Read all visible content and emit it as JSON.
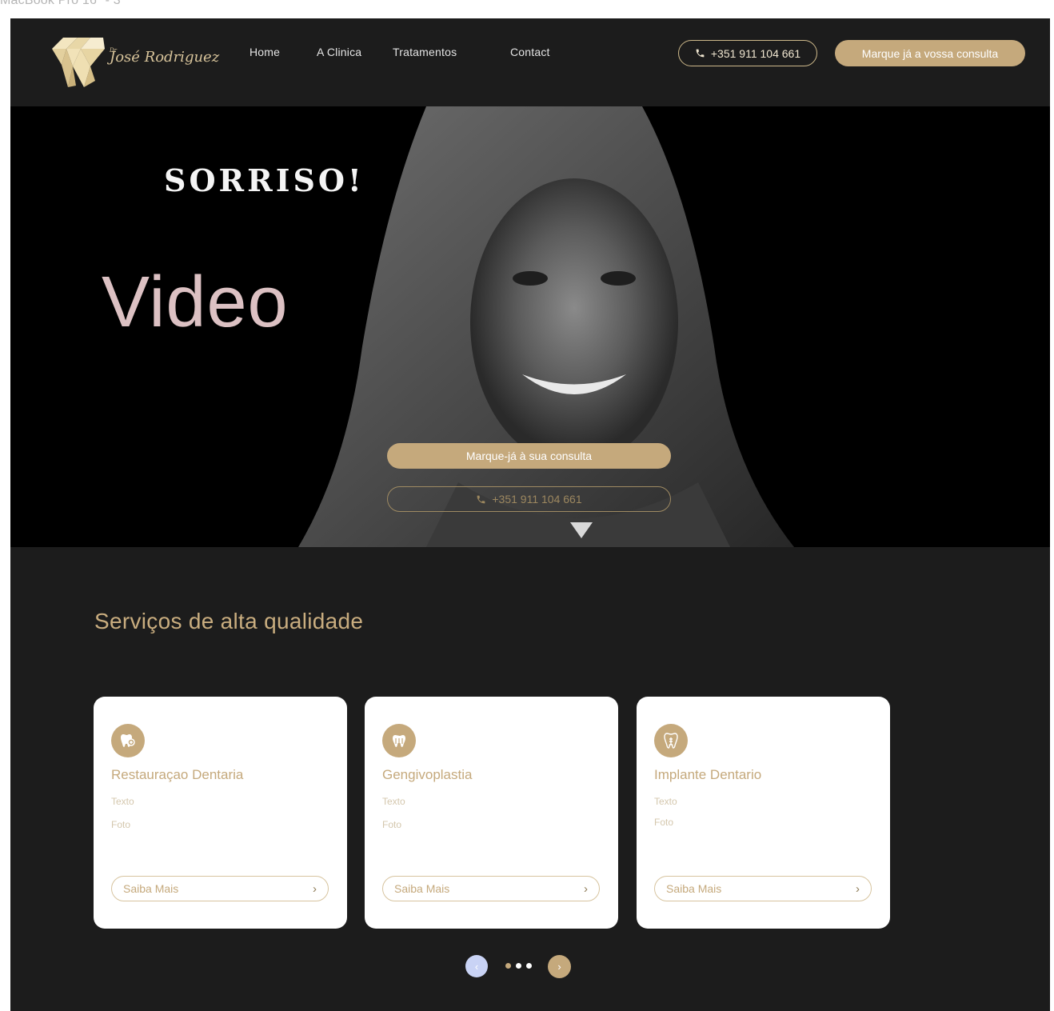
{
  "frame_label": "MacBook Pro 16\" - 3",
  "header": {
    "logo_dr": "Dr",
    "logo_name": "José Rodriguez",
    "nav": [
      "Home",
      "A Clinica",
      "Tratamentos",
      "Contact"
    ],
    "phone": "+351 911 104 661",
    "cta": "Marque já a vossa consulta"
  },
  "hero": {
    "brand": "SORRISO!",
    "video_label": "Video",
    "cta": "Marque-já à sua consulta",
    "phone": "+351 911 104 661"
  },
  "services": {
    "title": "Serviços de alta qualidade",
    "cards": [
      {
        "title": "Restauraçao Dentaria",
        "text": "Texto",
        "photo": "Foto",
        "button": "Saiba Mais",
        "icon": "tooth-plus-icon"
      },
      {
        "title": "Gengivoplastia",
        "text": "Texto",
        "photo": "Foto",
        "button": "Saiba Mais",
        "icon": "tooth-gum-icon"
      },
      {
        "title": "Implante Dentario",
        "text": "Texto",
        "photo": "Foto",
        "button": "Saiba Mais",
        "icon": "tooth-implant-icon"
      }
    ]
  },
  "pager": {
    "prev_icon": "chevron-left-icon",
    "next_icon": "chevron-right-icon",
    "pages": 3,
    "active_page": 1
  },
  "colors": {
    "background": "#1c1c1c",
    "gold": "#c5a97c",
    "card": "#ffffff",
    "video_text": "#dcc1c3",
    "prev_button": "#c9d3f5"
  }
}
